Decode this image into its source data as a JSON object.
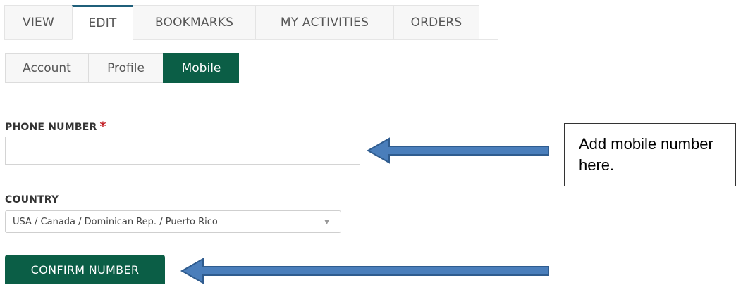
{
  "primary_tabs": [
    {
      "label": "VIEW",
      "active": false
    },
    {
      "label": "EDIT",
      "active": true
    },
    {
      "label": "BOOKMARKS",
      "active": false
    },
    {
      "label": "MY ACTIVITIES",
      "active": false
    },
    {
      "label": "ORDERS",
      "active": false
    }
  ],
  "secondary_tabs": [
    {
      "label": "Account",
      "active": false
    },
    {
      "label": "Profile",
      "active": false
    },
    {
      "label": "Mobile",
      "active": true
    }
  ],
  "form": {
    "phone_label": "PHONE NUMBER",
    "required_mark": "*",
    "phone_value": "",
    "country_label": "COUNTRY",
    "country_selected": "USA / Canada / Dominican Rep. / Puerto Rico",
    "confirm_label": "CONFIRM NUMBER"
  },
  "annotation": {
    "callout_text": "Add mobile number here."
  },
  "colors": {
    "accent_green": "#0b5e46",
    "tab_top_border": "#1f5f7a",
    "required_red": "#c0161d",
    "arrow_fill": "#4a7ebb",
    "arrow_stroke": "#2f5c8f"
  },
  "icons": {
    "select_caret": "chevron-down-icon",
    "arrows": "arrow-left-icon"
  }
}
